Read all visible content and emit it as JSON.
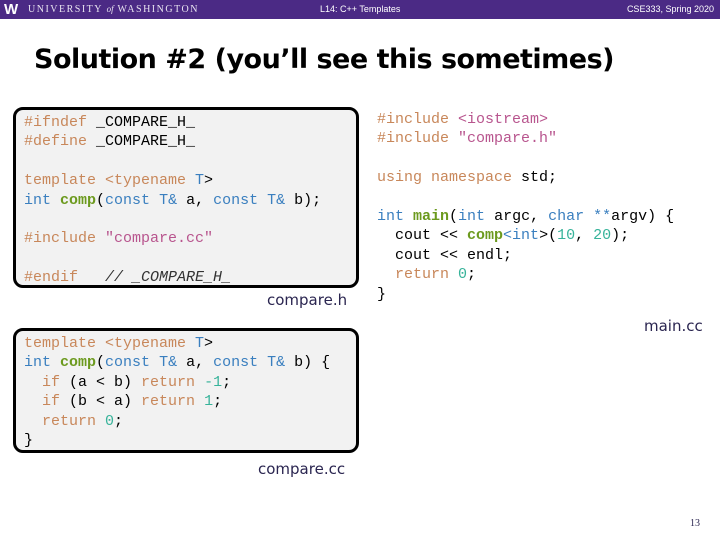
{
  "header": {
    "logo_glyph": "W",
    "university": "UNIVERSITY",
    "of": "of",
    "washington": "WASHINGTON",
    "lecture": "L14:  C++ Templates",
    "course": "CSE333, Spring 2020",
    "bar_color": "#4b2a85"
  },
  "slide": {
    "title": "Solution #2 (you’ll see this sometimes)",
    "page_number": "13"
  },
  "files": {
    "compare_h": {
      "label": "compare.h",
      "lines": [
        [
          {
            "t": "#ifndef ",
            "c": "pp"
          },
          {
            "t": "_COMPARE_H_",
            "c": ""
          }
        ],
        [
          {
            "t": "#define ",
            "c": "pp"
          },
          {
            "t": "_COMPARE_H_",
            "c": ""
          }
        ],
        [],
        [
          {
            "t": "template ",
            "c": "pp"
          },
          {
            "t": "<typename ",
            "c": "pp"
          },
          {
            "t": "T",
            "c": "kw"
          },
          {
            "t": ">",
            "c": ""
          }
        ],
        [
          {
            "t": "int ",
            "c": "kw"
          },
          {
            "t": "comp",
            "c": "fn"
          },
          {
            "t": "(",
            "c": ""
          },
          {
            "t": "const ",
            "c": "kw"
          },
          {
            "t": "T",
            "c": "kw"
          },
          {
            "t": "& ",
            "c": "kw"
          },
          {
            "t": "a, ",
            "c": ""
          },
          {
            "t": "const ",
            "c": "kw"
          },
          {
            "t": "T",
            "c": "kw"
          },
          {
            "t": "& ",
            "c": "kw"
          },
          {
            "t": "b);",
            "c": ""
          }
        ],
        [],
        [
          {
            "t": "#include ",
            "c": "pp"
          },
          {
            "t": "\"compare.cc\"",
            "c": "str"
          }
        ],
        [],
        [
          {
            "t": "#endif ",
            "c": "pp"
          },
          {
            "t": "  // _COMPARE_H_",
            "c": "cmt"
          }
        ]
      ]
    },
    "main_cc": {
      "label": "main.cc",
      "lines": [
        [
          {
            "t": "#include ",
            "c": "pp"
          },
          {
            "t": "<iostream>",
            "c": "str"
          }
        ],
        [
          {
            "t": "#include ",
            "c": "pp"
          },
          {
            "t": "\"compare.h\"",
            "c": "str"
          }
        ],
        [],
        [
          {
            "t": "using ",
            "c": "pp"
          },
          {
            "t": "namespace ",
            "c": "pp"
          },
          {
            "t": "std;",
            "c": ""
          }
        ],
        [],
        [
          {
            "t": "int ",
            "c": "kw"
          },
          {
            "t": "main",
            "c": "fn"
          },
          {
            "t": "(",
            "c": ""
          },
          {
            "t": "int ",
            "c": "kw"
          },
          {
            "t": "argc, ",
            "c": ""
          },
          {
            "t": "char ",
            "c": "kw"
          },
          {
            "t": "**",
            "c": "kw"
          },
          {
            "t": "argv) {",
            "c": ""
          }
        ],
        [
          {
            "t": "  cout << ",
            "c": ""
          },
          {
            "t": "comp",
            "c": "fn"
          },
          {
            "t": "<",
            "c": "kw"
          },
          {
            "t": "int",
            "c": "kw"
          },
          {
            "t": ">(",
            "c": ""
          },
          {
            "t": "10",
            "c": "num"
          },
          {
            "t": ", ",
            "c": ""
          },
          {
            "t": "20",
            "c": "num"
          },
          {
            "t": ");",
            "c": ""
          }
        ],
        [
          {
            "t": "  cout << endl;",
            "c": ""
          }
        ],
        [
          {
            "t": "  return ",
            "c": "ctl"
          },
          {
            "t": "0",
            "c": "num"
          },
          {
            "t": ";",
            "c": ""
          }
        ],
        [
          {
            "t": "}",
            "c": ""
          }
        ]
      ]
    },
    "compare_cc": {
      "label": "compare.cc",
      "lines": [
        [
          {
            "t": "template ",
            "c": "pp"
          },
          {
            "t": "<typename ",
            "c": "pp"
          },
          {
            "t": "T",
            "c": "kw"
          },
          {
            "t": ">",
            "c": ""
          }
        ],
        [
          {
            "t": "int ",
            "c": "kw"
          },
          {
            "t": "comp",
            "c": "fn"
          },
          {
            "t": "(",
            "c": ""
          },
          {
            "t": "const ",
            "c": "kw"
          },
          {
            "t": "T",
            "c": "kw"
          },
          {
            "t": "& ",
            "c": "kw"
          },
          {
            "t": "a, ",
            "c": ""
          },
          {
            "t": "const ",
            "c": "kw"
          },
          {
            "t": "T",
            "c": "kw"
          },
          {
            "t": "& ",
            "c": "kw"
          },
          {
            "t": "b) {",
            "c": ""
          }
        ],
        [
          {
            "t": "  ",
            "c": ""
          },
          {
            "t": "if ",
            "c": "ctl"
          },
          {
            "t": "(a < b) ",
            "c": ""
          },
          {
            "t": "return ",
            "c": "ctl"
          },
          {
            "t": "-1",
            "c": "num"
          },
          {
            "t": ";",
            "c": ""
          }
        ],
        [
          {
            "t": "  ",
            "c": ""
          },
          {
            "t": "if ",
            "c": "ctl"
          },
          {
            "t": "(b < a) ",
            "c": ""
          },
          {
            "t": "return ",
            "c": "ctl"
          },
          {
            "t": "1",
            "c": "num"
          },
          {
            "t": ";",
            "c": ""
          }
        ],
        [
          {
            "t": "  ",
            "c": ""
          },
          {
            "t": "return ",
            "c": "ctl"
          },
          {
            "t": "0",
            "c": "num"
          },
          {
            "t": ";",
            "c": ""
          }
        ],
        [
          {
            "t": "}",
            "c": ""
          }
        ]
      ]
    }
  }
}
